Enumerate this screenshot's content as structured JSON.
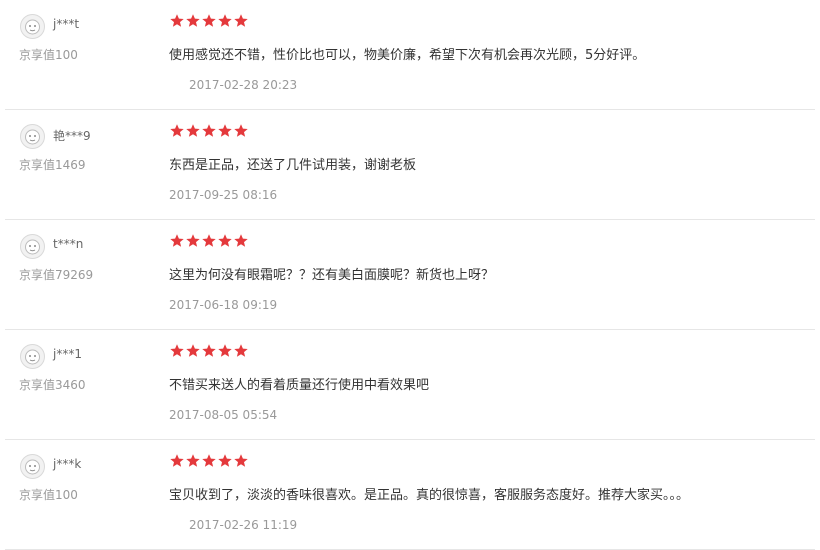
{
  "colors": {
    "star": "#e4393c",
    "divider": "#e6e6e6"
  },
  "icons": {
    "avatar": "default-avatar-icon",
    "star": "star-icon"
  },
  "reviews": [
    {
      "username": "j***t",
      "jingxiang": "京享值100",
      "rating": 5,
      "content": "使用感觉还不错，性价比也可以，物美价廉，希望下次有机会再次光顾，5分好评。",
      "time": "2017-02-28 20:23"
    },
    {
      "username": "艳***9",
      "jingxiang": "京享值1469",
      "rating": 5,
      "content": "东西是正品，还送了几件试用装，谢谢老板",
      "time": "2017-09-25 08:16"
    },
    {
      "username": "t***n",
      "jingxiang": "京享值79269",
      "rating": 5,
      "content": "这里为何没有眼霜呢？？还有美白面膜呢？新货也上呀？",
      "time": "2017-06-18 09:19"
    },
    {
      "username": "j***1",
      "jingxiang": "京享值3460",
      "rating": 5,
      "content": "不错买来送人的看着质量还行使用中看效果吧",
      "time": "2017-08-05 05:54"
    },
    {
      "username": "j***k",
      "jingxiang": "京享值100",
      "rating": 5,
      "content": "宝贝收到了，淡淡的香味很喜欢。是正品。真的很惊喜，客服服务态度好。推荐大家买。。。",
      "time": "2017-02-26 11:19"
    }
  ]
}
